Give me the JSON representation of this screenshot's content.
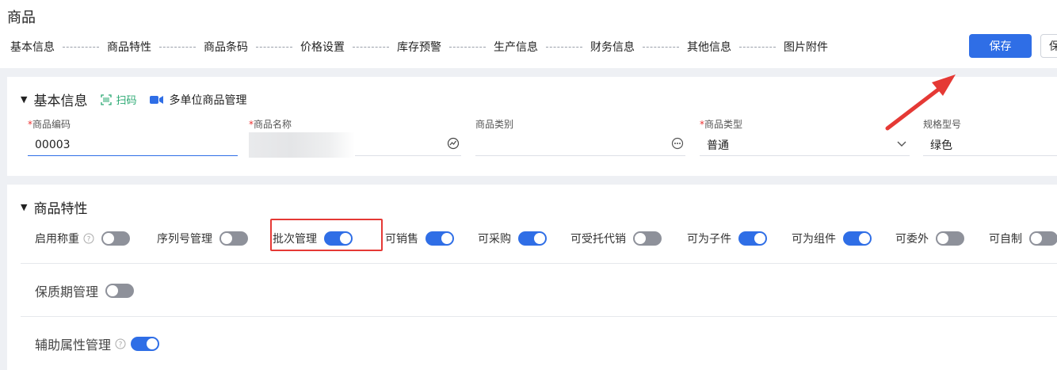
{
  "header": {
    "title": "商品",
    "steps": [
      "基本信息",
      "商品特性",
      "商品条码",
      "价格设置",
      "库存预警",
      "生产信息",
      "财务信息",
      "其他信息",
      "图片附件"
    ],
    "save_label": "保存",
    "save2_label": "保"
  },
  "basic": {
    "title": "基本信息",
    "scan_label": "扫码",
    "multi_label": "多单位商品管理",
    "fields": [
      {
        "label": "商品编码",
        "required": "*",
        "value": "00003"
      },
      {
        "label": "商品名称",
        "required": "*",
        "value": ""
      },
      {
        "label": "商品类别",
        "required": "",
        "value": ""
      },
      {
        "label": "商品类型",
        "required": "*",
        "value": "普通"
      },
      {
        "label": "规格型号",
        "required": "",
        "value": "绿色"
      }
    ]
  },
  "features": {
    "title": "商品特性",
    "toggles": [
      {
        "label": "启用称重",
        "on": false
      },
      {
        "label": "序列号管理",
        "on": false
      },
      {
        "label": "批次管理",
        "on": true
      },
      {
        "label": "可销售",
        "on": true
      },
      {
        "label": "可采购",
        "on": true
      },
      {
        "label": "可受托代销",
        "on": false
      },
      {
        "label": "可为子件",
        "on": true
      },
      {
        "label": "可为组件",
        "on": true
      },
      {
        "label": "可委外",
        "on": false
      },
      {
        "label": "可自制",
        "on": false
      }
    ],
    "shelf_life_label": "保质期管理",
    "shelf_life_on": false,
    "aux_attr_label": "辅助属性管理",
    "aux_attr_on": true
  },
  "colors": {
    "primary": "#2f6ee6",
    "toggle_off": "#8e919a",
    "scan_green": "#2aa872",
    "annotation_red": "#e53935"
  }
}
